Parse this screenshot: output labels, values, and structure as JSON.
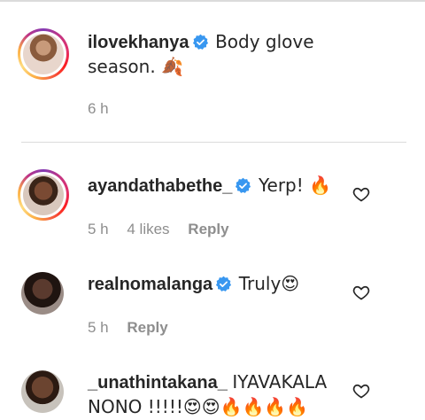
{
  "post": {
    "username": "ilovekhanya",
    "text": "Body glove season. 🍂",
    "time": "6 h"
  },
  "comments": [
    {
      "username": "ayandathabethe_",
      "text": "Yerp! 🔥",
      "time": "5 h",
      "likes": "4 likes",
      "reply": "Reply"
    },
    {
      "username": "realnomalanga",
      "text": "Truly😍",
      "time": "5 h",
      "reply": "Reply"
    },
    {
      "username": "_unathintakana_",
      "text": "IYAVAKALA NONO !!!!!😍😍🔥🔥🔥🔥"
    }
  ],
  "colors": {
    "verified": "#3897f0",
    "text": "#262626",
    "meta": "#8e8e8e"
  },
  "icons": [
    "verified-badge-icon",
    "heart-outline-icon"
  ]
}
